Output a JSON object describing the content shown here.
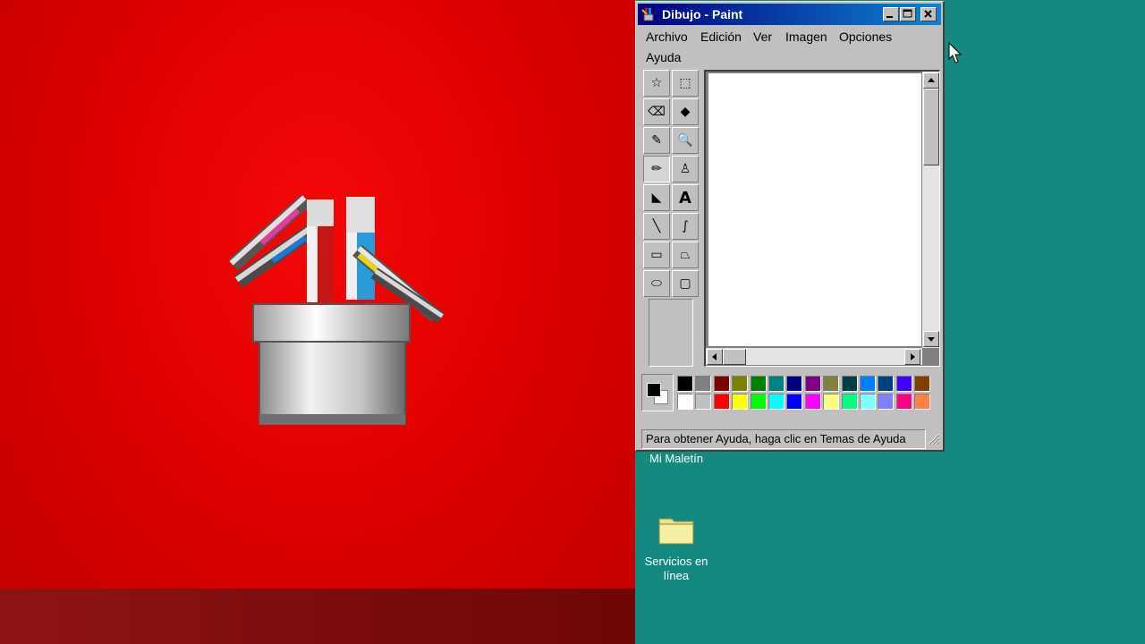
{
  "window": {
    "title": "Dibujo - Paint",
    "controls": [
      "minimize",
      "maximize",
      "close"
    ]
  },
  "menu": {
    "items": [
      "Archivo",
      "Edición",
      "Ver",
      "Imagen",
      "Opciones",
      "Ayuda"
    ]
  },
  "tools": [
    {
      "name": "free-form-select-icon",
      "glyph": "☆"
    },
    {
      "name": "rect-select-icon",
      "glyph": "⬚"
    },
    {
      "name": "eraser-icon",
      "glyph": "⌫"
    },
    {
      "name": "fill-bucket-icon",
      "glyph": "◆"
    },
    {
      "name": "color-picker-icon",
      "glyph": "✎"
    },
    {
      "name": "magnifier-icon",
      "glyph": "🔍"
    },
    {
      "name": "pencil-icon",
      "glyph": "✏"
    },
    {
      "name": "brush-icon",
      "glyph": "♙"
    },
    {
      "name": "airbrush-icon",
      "glyph": "◣"
    },
    {
      "name": "text-icon",
      "glyph": "A"
    },
    {
      "name": "line-icon",
      "glyph": "╲"
    },
    {
      "name": "curve-icon",
      "glyph": "∫"
    },
    {
      "name": "rectangle-icon",
      "glyph": "▭"
    },
    {
      "name": "polygon-icon",
      "glyph": "⏢"
    },
    {
      "name": "ellipse-icon",
      "glyph": "⬭"
    },
    {
      "name": "rounded-rect-icon",
      "glyph": "▢"
    }
  ],
  "selected_tool": "pencil-icon",
  "palette": {
    "foreground": "#000000",
    "background": "#ffffff",
    "top_row": [
      "#000000",
      "#808080",
      "#800000",
      "#808000",
      "#008000",
      "#008080",
      "#000080",
      "#800080",
      "#808040",
      "#004040",
      "#0080ff",
      "#004080",
      "#4000ff",
      "#804000"
    ],
    "bottom_row": [
      "#ffffff",
      "#c0c0c0",
      "#ff0000",
      "#ffff00",
      "#00ff00",
      "#00ffff",
      "#0000ff",
      "#ff00ff",
      "#ffff80",
      "#00ff80",
      "#80ffff",
      "#8080ff",
      "#ff0080",
      "#ff8040"
    ]
  },
  "statusbar": {
    "text": "Para obtener Ayuda, haga clic en Temas de Ayuda"
  },
  "desktop": {
    "icons": [
      {
        "label": "Mi Maletín"
      },
      {
        "label": "Servicios en línea"
      }
    ],
    "background_color": "#13897f",
    "splash_color": "#e00000"
  }
}
